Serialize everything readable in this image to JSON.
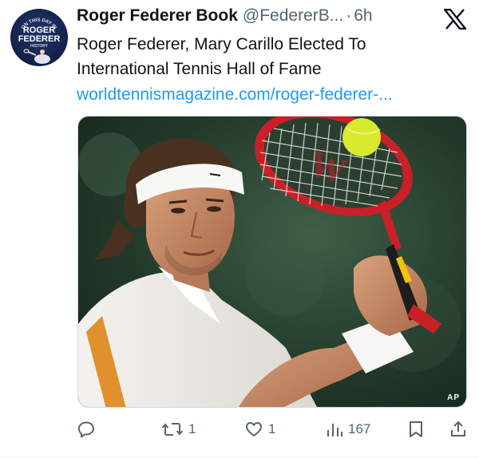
{
  "colors": {
    "text_primary": "#0f1419",
    "text_secondary": "#536471",
    "link": "#1d9bf0"
  },
  "avatar": {
    "badge_line1": "ON THIS DAY IN",
    "badge_line2": "ROGER",
    "badge_line3": "FEDERER",
    "badge_line4": "HISTORY"
  },
  "header": {
    "author_name": "Roger Federer Book",
    "handle": "@FedererB...",
    "separator": "·",
    "timestamp": "6h",
    "platform_icon": "x-logo-icon"
  },
  "tweet": {
    "text_line1": "Roger Federer, Mary Carillo Elected To",
    "text_line2": "International Tennis Hall of Fame",
    "link_text": "worldtennismagazine.com/roger-federer-..."
  },
  "media": {
    "credit": "AP"
  },
  "actions": {
    "reply": {
      "icon": "reply-icon",
      "count": ""
    },
    "retweet": {
      "icon": "retweet-icon",
      "count": "1"
    },
    "like": {
      "icon": "heart-icon",
      "count": "1"
    },
    "views": {
      "icon": "views-icon",
      "count": "167"
    },
    "bookmark": {
      "icon": "bookmark-icon"
    },
    "share": {
      "icon": "share-icon"
    }
  }
}
